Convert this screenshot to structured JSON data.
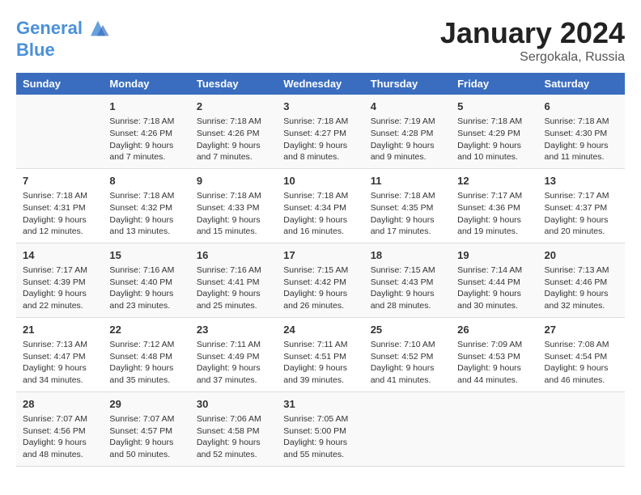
{
  "header": {
    "logo_line1": "General",
    "logo_line2": "Blue",
    "month": "January 2024",
    "location": "Sergokala, Russia"
  },
  "columns": [
    "Sunday",
    "Monday",
    "Tuesday",
    "Wednesday",
    "Thursday",
    "Friday",
    "Saturday"
  ],
  "weeks": [
    [
      {
        "day": "",
        "sunrise": "",
        "sunset": "",
        "daylight": ""
      },
      {
        "day": "1",
        "sunrise": "Sunrise: 7:18 AM",
        "sunset": "Sunset: 4:26 PM",
        "daylight": "Daylight: 9 hours and 7 minutes."
      },
      {
        "day": "2",
        "sunrise": "Sunrise: 7:18 AM",
        "sunset": "Sunset: 4:26 PM",
        "daylight": "Daylight: 9 hours and 7 minutes."
      },
      {
        "day": "3",
        "sunrise": "Sunrise: 7:18 AM",
        "sunset": "Sunset: 4:27 PM",
        "daylight": "Daylight: 9 hours and 8 minutes."
      },
      {
        "day": "4",
        "sunrise": "Sunrise: 7:19 AM",
        "sunset": "Sunset: 4:28 PM",
        "daylight": "Daylight: 9 hours and 9 minutes."
      },
      {
        "day": "5",
        "sunrise": "Sunrise: 7:18 AM",
        "sunset": "Sunset: 4:29 PM",
        "daylight": "Daylight: 9 hours and 10 minutes."
      },
      {
        "day": "6",
        "sunrise": "Sunrise: 7:18 AM",
        "sunset": "Sunset: 4:30 PM",
        "daylight": "Daylight: 9 hours and 11 minutes."
      }
    ],
    [
      {
        "day": "7",
        "sunrise": "Sunrise: 7:18 AM",
        "sunset": "Sunset: 4:31 PM",
        "daylight": "Daylight: 9 hours and 12 minutes."
      },
      {
        "day": "8",
        "sunrise": "Sunrise: 7:18 AM",
        "sunset": "Sunset: 4:32 PM",
        "daylight": "Daylight: 9 hours and 13 minutes."
      },
      {
        "day": "9",
        "sunrise": "Sunrise: 7:18 AM",
        "sunset": "Sunset: 4:33 PM",
        "daylight": "Daylight: 9 hours and 15 minutes."
      },
      {
        "day": "10",
        "sunrise": "Sunrise: 7:18 AM",
        "sunset": "Sunset: 4:34 PM",
        "daylight": "Daylight: 9 hours and 16 minutes."
      },
      {
        "day": "11",
        "sunrise": "Sunrise: 7:18 AM",
        "sunset": "Sunset: 4:35 PM",
        "daylight": "Daylight: 9 hours and 17 minutes."
      },
      {
        "day": "12",
        "sunrise": "Sunrise: 7:17 AM",
        "sunset": "Sunset: 4:36 PM",
        "daylight": "Daylight: 9 hours and 19 minutes."
      },
      {
        "day": "13",
        "sunrise": "Sunrise: 7:17 AM",
        "sunset": "Sunset: 4:37 PM",
        "daylight": "Daylight: 9 hours and 20 minutes."
      }
    ],
    [
      {
        "day": "14",
        "sunrise": "Sunrise: 7:17 AM",
        "sunset": "Sunset: 4:39 PM",
        "daylight": "Daylight: 9 hours and 22 minutes."
      },
      {
        "day": "15",
        "sunrise": "Sunrise: 7:16 AM",
        "sunset": "Sunset: 4:40 PM",
        "daylight": "Daylight: 9 hours and 23 minutes."
      },
      {
        "day": "16",
        "sunrise": "Sunrise: 7:16 AM",
        "sunset": "Sunset: 4:41 PM",
        "daylight": "Daylight: 9 hours and 25 minutes."
      },
      {
        "day": "17",
        "sunrise": "Sunrise: 7:15 AM",
        "sunset": "Sunset: 4:42 PM",
        "daylight": "Daylight: 9 hours and 26 minutes."
      },
      {
        "day": "18",
        "sunrise": "Sunrise: 7:15 AM",
        "sunset": "Sunset: 4:43 PM",
        "daylight": "Daylight: 9 hours and 28 minutes."
      },
      {
        "day": "19",
        "sunrise": "Sunrise: 7:14 AM",
        "sunset": "Sunset: 4:44 PM",
        "daylight": "Daylight: 9 hours and 30 minutes."
      },
      {
        "day": "20",
        "sunrise": "Sunrise: 7:13 AM",
        "sunset": "Sunset: 4:46 PM",
        "daylight": "Daylight: 9 hours and 32 minutes."
      }
    ],
    [
      {
        "day": "21",
        "sunrise": "Sunrise: 7:13 AM",
        "sunset": "Sunset: 4:47 PM",
        "daylight": "Daylight: 9 hours and 34 minutes."
      },
      {
        "day": "22",
        "sunrise": "Sunrise: 7:12 AM",
        "sunset": "Sunset: 4:48 PM",
        "daylight": "Daylight: 9 hours and 35 minutes."
      },
      {
        "day": "23",
        "sunrise": "Sunrise: 7:11 AM",
        "sunset": "Sunset: 4:49 PM",
        "daylight": "Daylight: 9 hours and 37 minutes."
      },
      {
        "day": "24",
        "sunrise": "Sunrise: 7:11 AM",
        "sunset": "Sunset: 4:51 PM",
        "daylight": "Daylight: 9 hours and 39 minutes."
      },
      {
        "day": "25",
        "sunrise": "Sunrise: 7:10 AM",
        "sunset": "Sunset: 4:52 PM",
        "daylight": "Daylight: 9 hours and 41 minutes."
      },
      {
        "day": "26",
        "sunrise": "Sunrise: 7:09 AM",
        "sunset": "Sunset: 4:53 PM",
        "daylight": "Daylight: 9 hours and 44 minutes."
      },
      {
        "day": "27",
        "sunrise": "Sunrise: 7:08 AM",
        "sunset": "Sunset: 4:54 PM",
        "daylight": "Daylight: 9 hours and 46 minutes."
      }
    ],
    [
      {
        "day": "28",
        "sunrise": "Sunrise: 7:07 AM",
        "sunset": "Sunset: 4:56 PM",
        "daylight": "Daylight: 9 hours and 48 minutes."
      },
      {
        "day": "29",
        "sunrise": "Sunrise: 7:07 AM",
        "sunset": "Sunset: 4:57 PM",
        "daylight": "Daylight: 9 hours and 50 minutes."
      },
      {
        "day": "30",
        "sunrise": "Sunrise: 7:06 AM",
        "sunset": "Sunset: 4:58 PM",
        "daylight": "Daylight: 9 hours and 52 minutes."
      },
      {
        "day": "31",
        "sunrise": "Sunrise: 7:05 AM",
        "sunset": "Sunset: 5:00 PM",
        "daylight": "Daylight: 9 hours and 55 minutes."
      },
      {
        "day": "",
        "sunrise": "",
        "sunset": "",
        "daylight": ""
      },
      {
        "day": "",
        "sunrise": "",
        "sunset": "",
        "daylight": ""
      },
      {
        "day": "",
        "sunrise": "",
        "sunset": "",
        "daylight": ""
      }
    ]
  ]
}
